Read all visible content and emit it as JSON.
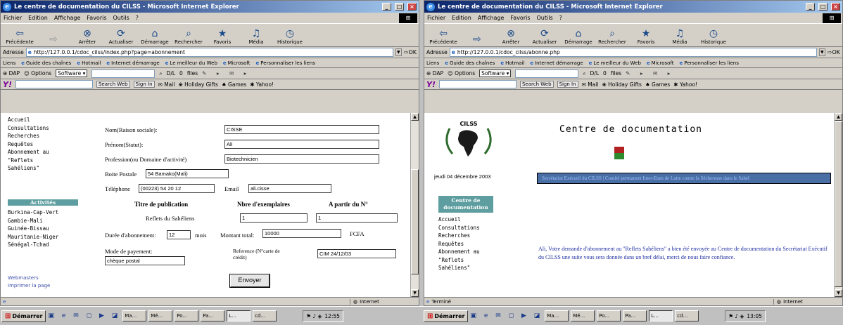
{
  "left": {
    "title": "Le centre de documentation du CILSS - Microsoft Internet Explorer",
    "menu": [
      "Fichier",
      "Edition",
      "Affichage",
      "Favoris",
      "Outils",
      "?"
    ],
    "toolbar": [
      "Précédente",
      "",
      "Arrêter",
      "Actualiser",
      "Démarrage",
      "Rechercher",
      "Favoris",
      "Média",
      "Historique"
    ],
    "address": {
      "label": "Adresse",
      "url": "http://127.0.0.1/cdoc_cilss/index.php?page=abonnement",
      "go": "OK"
    },
    "links": {
      "label": "Liens",
      "items": [
        "Guide des chaînes",
        "Hotmail",
        "Internet démarrage",
        "Le meilleur du Web",
        "Microsoft",
        "Personnaliser les liens"
      ]
    },
    "dap": {
      "dap": "DAP",
      "options": "Options",
      "software": "Software",
      "dl": "D/L",
      "count": "0",
      "files": "files"
    },
    "yahoo": {
      "logo": "Y!",
      "search": "Search Web",
      "signin": "Sign In",
      "mail": "Mail",
      "holiday": "Holiday Gifts",
      "games": "Games",
      "yahoo": "Yahoo!"
    },
    "status": {
      "left": "",
      "zone": "Internet"
    },
    "sidebar": {
      "top_links": [
        "Accueil",
        "Consultations",
        "Recherches",
        "Requêtes",
        "Abonnement au",
        "\"Reflets",
        "Sahéliens\""
      ],
      "activities_title": "Activités",
      "activities": [
        "Burkina-Cap-Vert",
        "Gambie-Mali",
        "Guinée-Bissau",
        "Mauritanie-Niger",
        "Sénégal-Tchad"
      ],
      "bottom_links": [
        "Webmasters",
        "Imprimer la page"
      ]
    },
    "form": {
      "nom_label": "Nom(Raison sociale):",
      "nom_value": "CISSE",
      "prenom_label": "Prénom(Statut):",
      "prenom_value": "Ali",
      "profession_label": "Profession(ou Domaine d'activité)",
      "profession_value": "Biotechnicien",
      "bp_label": "Boite Postale",
      "bp_value": "54 Bamako(Mali)",
      "tel_label": "Téléphone",
      "tel_value": "(00223) 54 20 12",
      "email_label": "Email",
      "email_value": "ali.cisse",
      "col_titre": "Titre de publication",
      "col_nbre": "Nbre d'exemplaires",
      "col_partir": "A partir du N°",
      "publication": "Reflets du Sahéliens",
      "nbre_value": "1",
      "partir_value": "1",
      "duree_label": "Durée d'abonnement:",
      "duree_value": "12",
      "duree_unit": "mois",
      "montant_label": "Montant total:",
      "montant_value": "10000",
      "montant_unit": "FCFA",
      "paiement_label": "Mode de payement:",
      "paiement_value": "chèque postal",
      "reference_label": "Reference (N°carte de crédit)",
      "reference_value": "CIM 24/12/03",
      "submit": "Envoyer"
    }
  },
  "right": {
    "title": "Le centre de documentation du CILSS - Microsoft Internet Explorer",
    "menu": [
      "Fichier",
      "Edition",
      "Affichage",
      "Favoris",
      "Outils",
      "?"
    ],
    "toolbar": [
      "Précédente",
      "",
      "Arrêter",
      "Actualiser",
      "Démarrage",
      "Rechercher",
      "Favoris",
      "Média",
      "Historique"
    ],
    "address": {
      "label": "Adresse",
      "url": "http://127.0.0.1/cdoc_cilss/abonne.php",
      "go": "OK"
    },
    "links": {
      "label": "Liens",
      "items": [
        "Guide des chaînes",
        "Hotmail",
        "Internet démarrage",
        "Le meilleur du Web",
        "Microsoft",
        "Personnaliser les liens"
      ]
    },
    "dap": {
      "dap": "DAP",
      "options": "Options",
      "software": "Software",
      "dl": "D/L",
      "count": "0",
      "files": "files"
    },
    "yahoo": {
      "logo": "Y!",
      "search": "Search Web",
      "signin": "Sign In",
      "mail": "Mail",
      "holiday": "Holiday Gifts",
      "games": "Games",
      "yahoo": "Yahoo!"
    },
    "status": {
      "left": "Terminé",
      "zone": "Internet"
    },
    "logo_text": "CILSS",
    "header_title": "Centre de documentation",
    "date": "jeudi 04 décembre 2003",
    "banner": "Secrétariat Exécutif du CILSS | Comité permanent Inter-Etats de Lutte contre la Sécheresse dans le Sahel",
    "sidebar": {
      "title": "Centre de documentation",
      "links": [
        "Accueil",
        "Consultations",
        "Recherches",
        "Requêtes",
        "Abonnement au",
        "\"Reflets",
        "Sahéliens\""
      ]
    },
    "confirmation": "Ali, Votre demande d'abonnement au \"Reflets Sahéliens\" a bien été envoyée au Centre de documentation du Secrétariat Exécutif du CILSS une suite vous sera donnée dans un bref délai, merci de nous faire confiance."
  },
  "taskbar": {
    "start": "Démarrer",
    "left_tasks": [
      "Ma...",
      "Mé...",
      "Po...",
      "Pa...",
      "L...",
      "cd..."
    ],
    "right_tasks": [
      "Ma...",
      "Mé...",
      "Po...",
      "Pa...",
      "L...",
      "cd..."
    ],
    "clock_left": "12:55",
    "clock_right": "13:05"
  },
  "colors": {
    "title_start": "#0a246a",
    "title_end": "#a6caf0",
    "sidebar_heading": "#5f9ea0",
    "banner": "#4a6fa5",
    "confirmation_text": "#1f2fa0",
    "flag_red": "#b22222",
    "flag_green": "#2e8b2e"
  }
}
